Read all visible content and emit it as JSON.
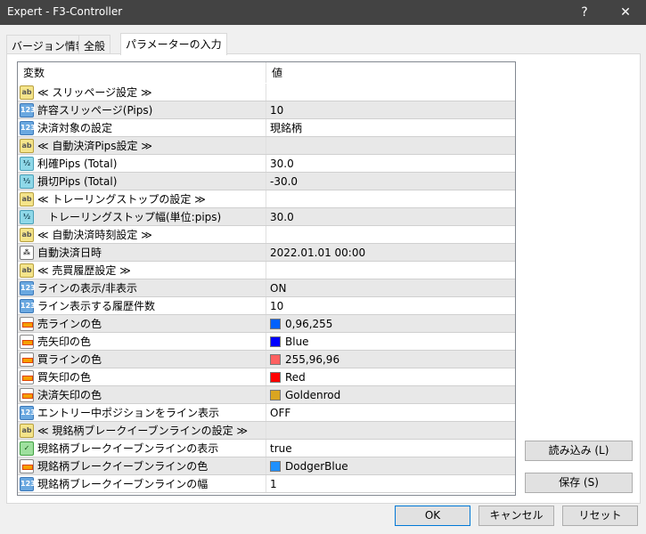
{
  "window": {
    "title": "Expert - F3-Controller",
    "help": "?",
    "close": "✕"
  },
  "tabs": [
    {
      "label": "バージョン情報"
    },
    {
      "label": "全般"
    },
    {
      "label": "パラメーターの入力",
      "active": true
    }
  ],
  "grid": {
    "headers": {
      "variable": "変数",
      "value": "値"
    },
    "rows": [
      {
        "icon": "string",
        "label": "≪ スリッページ設定 ≫",
        "value": ""
      },
      {
        "icon": "int",
        "label": "許容スリッページ(Pips)",
        "value": "10"
      },
      {
        "icon": "int",
        "label": "決済対象の設定",
        "value": "現銘柄"
      },
      {
        "icon": "string",
        "label": "≪ 自動決済Pips設定 ≫",
        "value": ""
      },
      {
        "icon": "double",
        "label": "利確Pips (Total)",
        "value": "30.0"
      },
      {
        "icon": "double",
        "label": "損切Pips (Total)",
        "value": "-30.0"
      },
      {
        "icon": "string",
        "label": "≪ トレーリングストップの設定 ≫",
        "value": ""
      },
      {
        "icon": "double",
        "label": "　トレーリングストップ幅(単位:pips)",
        "value": "30.0"
      },
      {
        "icon": "string",
        "label": "≪ 自動決済時刻設定 ≫",
        "value": ""
      },
      {
        "icon": "datetime",
        "label": "自動決済日時",
        "value": "2022.01.01 00:00"
      },
      {
        "icon": "string",
        "label": "≪ 売買履歴設定 ≫",
        "value": ""
      },
      {
        "icon": "int",
        "label": "ラインの表示/非表示",
        "value": "ON"
      },
      {
        "icon": "int",
        "label": "ライン表示する履歴件数",
        "value": "10"
      },
      {
        "icon": "color",
        "label": "売ラインの色",
        "value": "0,96,255",
        "swatch": "#0060ff"
      },
      {
        "icon": "color",
        "label": "売矢印の色",
        "value": "Blue",
        "swatch": "#0000ff"
      },
      {
        "icon": "color",
        "label": "買ラインの色",
        "value": "255,96,96",
        "swatch": "#ff6060"
      },
      {
        "icon": "color",
        "label": "買矢印の色",
        "value": "Red",
        "swatch": "#ff0000"
      },
      {
        "icon": "color",
        "label": "決済矢印の色",
        "value": "Goldenrod",
        "swatch": "#daa520"
      },
      {
        "icon": "int",
        "label": "エントリー中ポジションをライン表示",
        "value": "OFF"
      },
      {
        "icon": "string",
        "label": "≪ 現銘柄ブレークイーブンラインの設定 ≫",
        "value": ""
      },
      {
        "icon": "bool",
        "label": "現銘柄ブレークイーブンラインの表示",
        "value": "true"
      },
      {
        "icon": "color",
        "label": "現銘柄ブレークイーブンラインの色",
        "value": "DodgerBlue",
        "swatch": "#1e90ff"
      },
      {
        "icon": "int",
        "label": "現銘柄ブレークイーブンラインの幅",
        "value": "1"
      }
    ]
  },
  "buttons": {
    "load": "読み込み (L)",
    "save": "保存 (S)",
    "ok": "OK",
    "cancel": "キャンセル",
    "reset": "リセット"
  }
}
